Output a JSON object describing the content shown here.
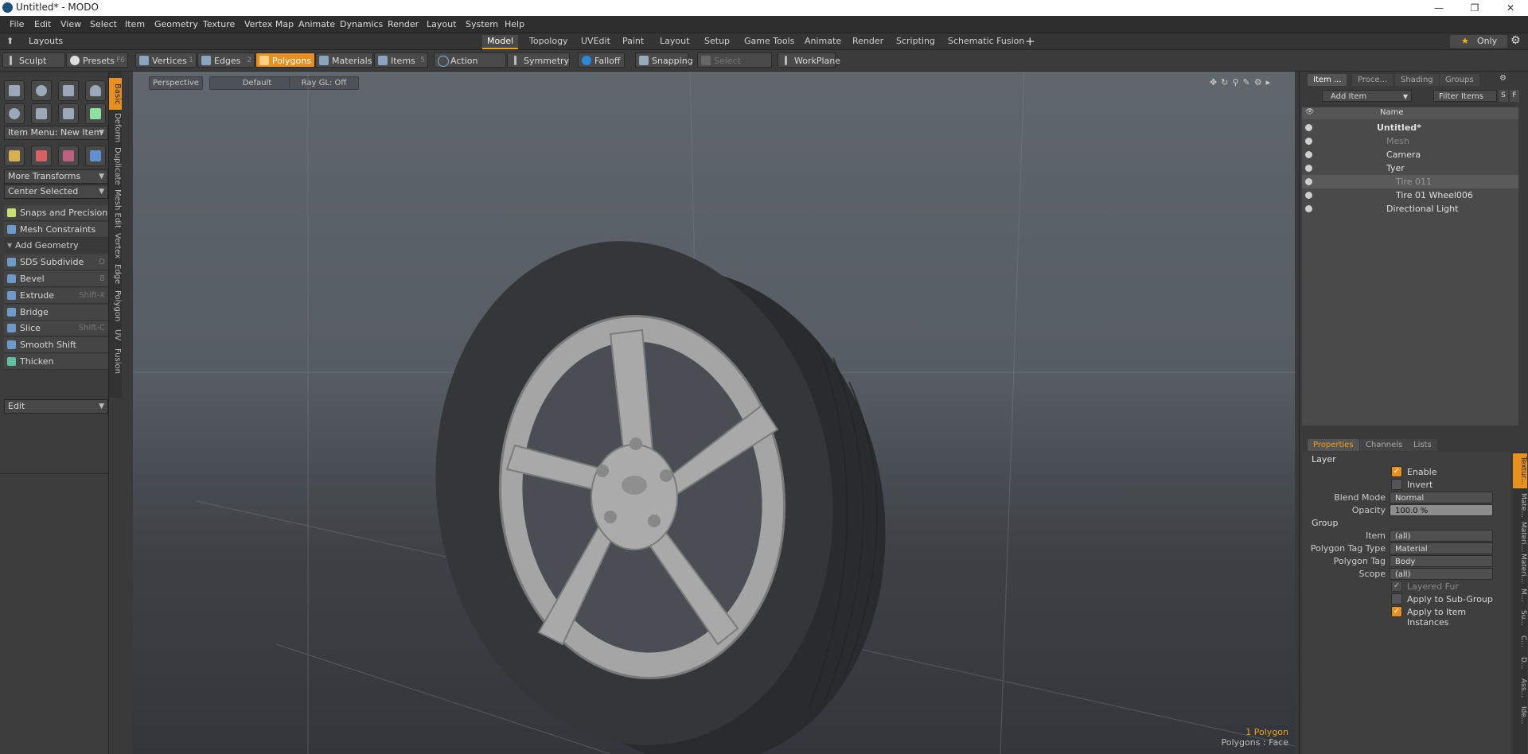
{
  "window": {
    "title": "Untitled* - MODO"
  },
  "menubar": [
    "File",
    "Edit",
    "View",
    "Select",
    "Item",
    "Geometry",
    "Texture",
    "Vertex Map",
    "Animate",
    "Dynamics",
    "Render",
    "Layout",
    "System",
    "Help"
  ],
  "layouts": {
    "label": "Layouts",
    "tabs": [
      "Model",
      "Topology",
      "UVEdit",
      "Paint",
      "Layout",
      "Setup",
      "Game Tools",
      "Animate",
      "Render",
      "Scripting",
      "Schematic Fusion"
    ],
    "only_label": "Only"
  },
  "toolbar": {
    "sculpt": "Sculpt",
    "presets": "Presets",
    "presets_key": "F6",
    "vertices": "Vertices",
    "edges": "Edges",
    "polygons": "Polygons",
    "materials": "Materials",
    "items": "Items",
    "action_center": "Action Center",
    "symmetry": "Symmetry",
    "falloff": "Falloff",
    "snapping": "Snapping",
    "select_through": "Select Through",
    "workplane": "WorkPlane"
  },
  "toolbox": {
    "side_tabs": [
      "Basic",
      "Deform",
      "Duplicate",
      "Mesh Edit",
      "Vertex",
      "Edge",
      "Polygon",
      "UV",
      "Fusion"
    ],
    "item_menu": "Item Menu: New Item",
    "more_transforms": "More Transforms",
    "center_selected": "Center Selected",
    "snaps": "Snaps and Precision",
    "mesh_constraints": "Mesh Constraints",
    "add_geometry": "Add Geometry",
    "tools": [
      {
        "label": "SDS Subdivide",
        "key": "D"
      },
      {
        "label": "Bevel",
        "key": "B"
      },
      {
        "label": "Extrude",
        "key": "Shift-X"
      },
      {
        "label": "Bridge",
        "key": ""
      },
      {
        "label": "Slice",
        "key": "Shift-C"
      },
      {
        "label": "Smooth Shift",
        "key": ""
      },
      {
        "label": "Thicken",
        "key": ""
      }
    ],
    "edit_dropdown": "Edit"
  },
  "viewport": {
    "view": "Perspective",
    "shading": "Default",
    "raygl": "Ray GL: Off",
    "status_count": "1 Polygon",
    "status_mode": "Polygons : Face"
  },
  "item_panel": {
    "tabs": [
      "Item ...",
      "Proce...",
      "Shading",
      "Groups"
    ],
    "add_item": "Add Item",
    "filter_items": "Filter Items",
    "btn_s": "S",
    "btn_f": "F",
    "name_header": "Name",
    "items": [
      {
        "label": "Untitled*",
        "depth": 0
      },
      {
        "label": "Mesh",
        "depth": 1
      },
      {
        "label": "Camera",
        "depth": 1
      },
      {
        "label": "Tyer",
        "depth": 1
      },
      {
        "label": "Tire 011",
        "depth": 2
      },
      {
        "label": "Tire 01 Wheel006",
        "depth": 2
      },
      {
        "label": "Directional Light",
        "depth": 1
      }
    ]
  },
  "properties": {
    "tabs": [
      "Properties",
      "Channels",
      "Lists"
    ],
    "side_tabs": [
      "Textur...",
      "Mate...",
      "Materi...",
      "Materi...",
      "M...",
      "Su...",
      "C...",
      "D...",
      "Ass...",
      "Ide..."
    ],
    "layer_header": "Layer",
    "enable": "Enable",
    "invert": "Invert",
    "blend_mode_label": "Blend Mode",
    "blend_mode": "Normal",
    "opacity_label": "Opacity",
    "opacity": "100.0 %",
    "group_header": "Group",
    "item_label": "Item",
    "item_value": "(all)",
    "ptag_type_label": "Polygon Tag Type",
    "ptag_type": "Material",
    "ptag_label": "Polygon Tag",
    "ptag": "Body",
    "scope_label": "Scope",
    "scope": "(all)",
    "layered_fur": "Layered Fur",
    "apply_subgroup": "Apply to Sub-Group",
    "apply_instances": "Apply to Item Instances"
  }
}
